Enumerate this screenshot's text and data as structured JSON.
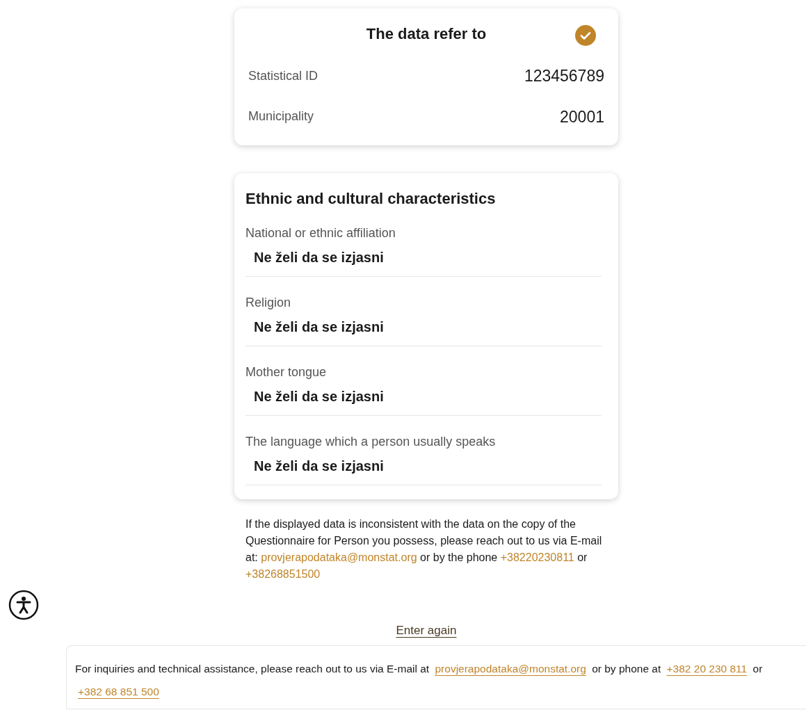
{
  "summary_card": {
    "title": "The data refer to",
    "rows": [
      {
        "label": "Statistical ID",
        "value": "123456789"
      },
      {
        "label": "Municipality",
        "value": "20001"
      }
    ]
  },
  "characteristics_card": {
    "title": "Ethnic and cultural characteristics",
    "fields": [
      {
        "label": "National or ethnic affiliation",
        "value": "Ne želi da se izjasni"
      },
      {
        "label": "Religion",
        "value": "Ne želi da se izjasni"
      },
      {
        "label": "Mother tongue",
        "value": "Ne želi da se izjasni"
      },
      {
        "label": "The language which a person usually speaks",
        "value": "Ne želi da se izjasni"
      }
    ]
  },
  "note": [
    {
      "kind": "text",
      "text": "If the displayed data is inconsistent with the data on the copy of the Questionnaire for Person you possess, please reach out to us via E-mail at: "
    },
    {
      "kind": "link",
      "text": "provjerapodataka@monstat.org"
    },
    {
      "kind": "text",
      "text": " or by the phone "
    },
    {
      "kind": "link",
      "text": "+38220230811"
    },
    {
      "kind": "text",
      "text": " or "
    },
    {
      "kind": "link",
      "text": "+38268851500"
    }
  ],
  "enter_again": "Enter again",
  "footer": [
    {
      "kind": "text",
      "text": "For inquiries and technical assistance, please reach out to us via E-mail at "
    },
    {
      "kind": "link",
      "text": "provjerapodataka@monstat.org"
    },
    {
      "kind": "text",
      "text": " or by phone at "
    },
    {
      "kind": "link",
      "text": "+382 20 230 811"
    },
    {
      "kind": "text",
      "text": " or "
    },
    {
      "kind": "link",
      "text": "+382 68 851 500"
    }
  ]
}
